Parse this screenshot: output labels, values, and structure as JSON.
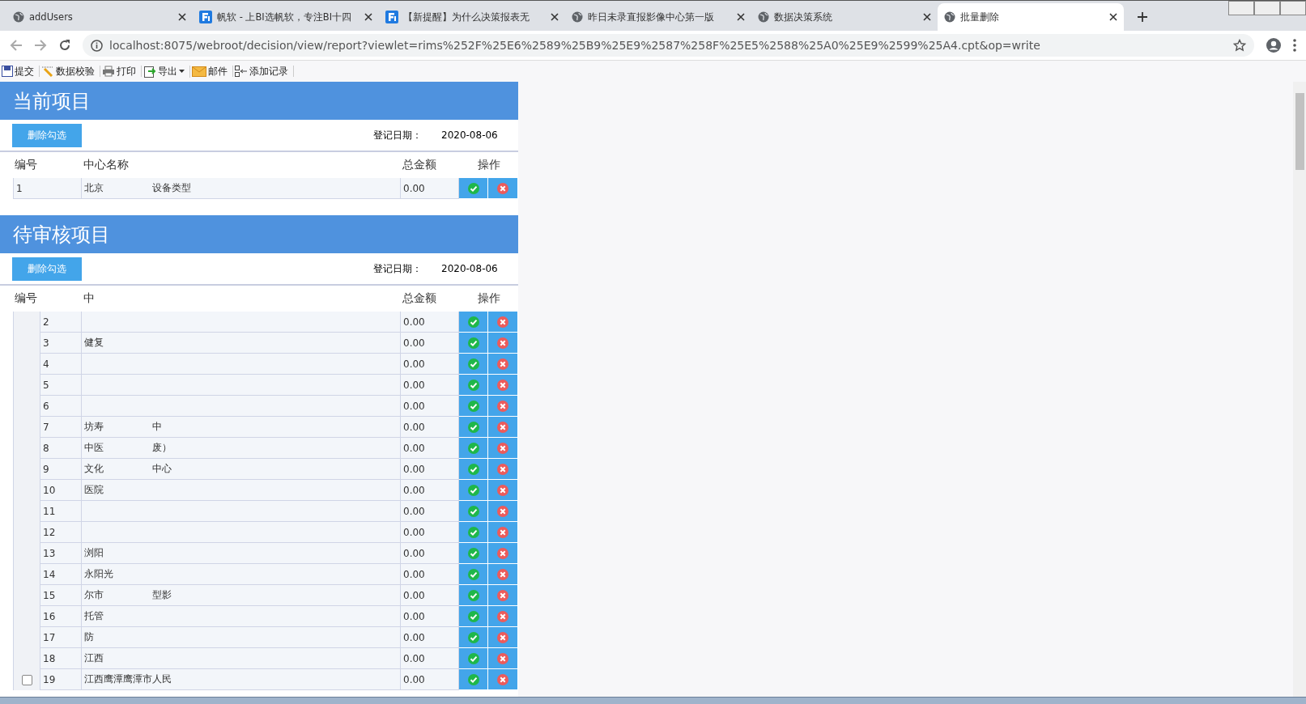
{
  "browser": {
    "tabs": [
      {
        "title": "addUsers",
        "kind": "globe",
        "selected": false
      },
      {
        "title": "帆软 - 上BI选帆软，专注BI十四",
        "kind": "brand",
        "selected": false
      },
      {
        "title": "【新提醒】为什么决策报表无",
        "kind": "brand",
        "selected": false
      },
      {
        "title": "昨日未录直报影像中心第一版",
        "kind": "globe",
        "selected": false
      },
      {
        "title": "数据决策系统",
        "kind": "globe",
        "selected": false
      },
      {
        "title": "批量删除",
        "kind": "globe",
        "selected": true
      }
    ],
    "url": "localhost:8075/webroot/decision/view/report?viewlet=rims%252F%25E6%2589%25B9%25E9%2587%258F%25E5%2588%25A0%25E9%2599%25A4.cpt&op=write"
  },
  "toolbar": [
    {
      "label": "提交",
      "dropdown": false
    },
    {
      "label": "数据校验",
      "dropdown": false
    },
    {
      "label": "打印",
      "dropdown": false
    },
    {
      "label": "导出",
      "dropdown": true
    },
    {
      "label": "邮件",
      "dropdown": false
    },
    {
      "label": "添加记录",
      "dropdown": false
    }
  ],
  "sections": [
    {
      "title": "当前项目",
      "button": "删除勾选",
      "date_label": "登记日期：",
      "date": "2020-08-06",
      "has_checkbox_column": false,
      "columns": [
        "编号",
        "中心名称",
        "总金额",
        "操作"
      ],
      "rows": [
        {
          "id": "1",
          "name_parts": [
            "北京",
            "设备类型"
          ],
          "amount": "0.00"
        }
      ]
    },
    {
      "title": "待审核项目",
      "button": "删除勾选",
      "date_label": "登记日期：",
      "date": "2020-08-06",
      "has_checkbox_column": true,
      "checked": false,
      "columns": [
        "编号",
        "中",
        "总金额",
        "操作"
      ],
      "rows": [
        {
          "id": "2",
          "name_parts": [],
          "amount": "0.00"
        },
        {
          "id": "3",
          "name_parts": [
            "健复"
          ],
          "amount": "0.00"
        },
        {
          "id": "4",
          "name_parts": [],
          "amount": "0.00"
        },
        {
          "id": "5",
          "name_parts": [],
          "amount": "0.00"
        },
        {
          "id": "6",
          "name_parts": [],
          "amount": "0.00"
        },
        {
          "id": "7",
          "name_parts": [
            "坊寿",
            "中"
          ],
          "amount": "0.00"
        },
        {
          "id": "8",
          "name_parts": [
            "中医",
            "废）"
          ],
          "amount": "0.00"
        },
        {
          "id": "9",
          "name_parts": [
            "文化",
            "中心"
          ],
          "amount": "0.00"
        },
        {
          "id": "10",
          "name_parts": [
            "医院"
          ],
          "amount": "0.00"
        },
        {
          "id": "11",
          "name_parts": [],
          "amount": "0.00"
        },
        {
          "id": "12",
          "name_parts": [],
          "amount": "0.00"
        },
        {
          "id": "13",
          "name_parts": [
            "浏阳"
          ],
          "amount": "0.00"
        },
        {
          "id": "14",
          "name_parts": [
            "永阳光"
          ],
          "amount": "0.00"
        },
        {
          "id": "15",
          "name_parts": [
            "尔市",
            "型影"
          ],
          "amount": "0.00"
        },
        {
          "id": "16",
          "name_parts": [
            "托管"
          ],
          "amount": "0.00"
        },
        {
          "id": "17",
          "name_parts": [
            "防"
          ],
          "amount": "0.00"
        },
        {
          "id": "18",
          "name_parts": [
            "江西"
          ],
          "amount": "0.00"
        },
        {
          "id": "19",
          "name_parts": [
            "江西鹰潭鹰潭市人民"
          ],
          "amount": "0.00"
        }
      ]
    }
  ]
}
